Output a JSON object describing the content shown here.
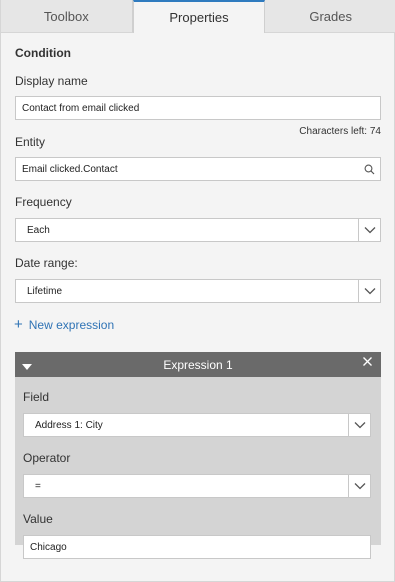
{
  "tabs": [
    {
      "label": "Toolbox"
    },
    {
      "label": "Properties"
    },
    {
      "label": "Grades"
    }
  ],
  "condition": {
    "heading": "Condition",
    "display_name_label": "Display name",
    "display_name_value": "Contact from email clicked",
    "characters_left": "Characters left: 74",
    "entity_label": "Entity",
    "entity_value": "Email clicked.Contact",
    "frequency_label": "Frequency",
    "frequency_value": "Each",
    "date_range_label": "Date range:",
    "date_range_value": "Lifetime",
    "new_expression_label": "New expression"
  },
  "expression": {
    "title": "Expression 1",
    "field_label": "Field",
    "field_value": "Address 1: City",
    "operator_label": "Operator",
    "operator_value": "=",
    "value_label": "Value",
    "value_value": "Chicago"
  },
  "icons": {
    "search": "search-icon",
    "dropdown": "chevron-down-icon",
    "collapse": "caret-down-icon",
    "close": "close-icon",
    "add": "plus-icon"
  },
  "colors": {
    "accent": "#2f7bbf",
    "link": "#2f73b5",
    "expression_header": "#6a6a6a",
    "expression_body": "#d4d4d4"
  }
}
